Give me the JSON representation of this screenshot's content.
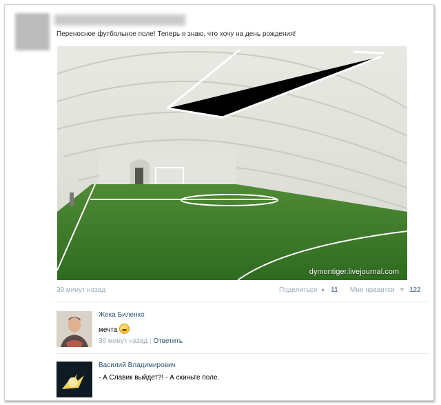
{
  "post": {
    "text": "Переносное футбольное поле! Теперь я знаю, что хочу на день рождения!",
    "photo_watermark": "dymontiger.livejournal.com",
    "time": "39 минут назад",
    "share_label": "Поделиться",
    "share_count": "11",
    "like_label": "Мне нравится",
    "like_count": "122"
  },
  "comments": [
    {
      "author": "Жека Биленко",
      "text": "мечта",
      "time": "36 минут назад",
      "separator": "|",
      "reply": "Ответить"
    },
    {
      "author": "Василий Владимирович",
      "text": "- А Славик выйдет?! - А скиньте поле."
    }
  ],
  "icons": {
    "share": "megaphone-icon",
    "like": "heart-icon",
    "emoji": "smiley-icon"
  },
  "colors": {
    "link": "#2b587a",
    "meta": "#9aa8b8",
    "count": "#6f86a3"
  }
}
